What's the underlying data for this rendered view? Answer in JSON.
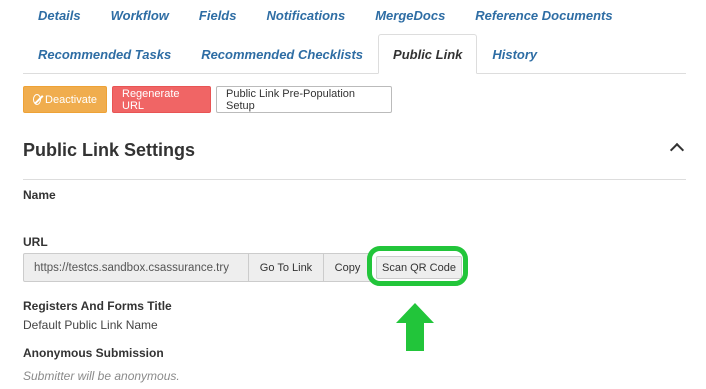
{
  "tabs_row1": [
    "Details",
    "Workflow",
    "Fields",
    "Notifications",
    "MergeDocs",
    "Reference Documents"
  ],
  "tabs_row2": [
    "Recommended Tasks",
    "Recommended Checklists",
    "Public Link",
    "History"
  ],
  "active_tab": "Public Link",
  "buttons": {
    "deactivate": "Deactivate",
    "regenerate": "Regenerate URL",
    "prepopulation": "Public Link Pre-Population Setup"
  },
  "section": {
    "title": "Public Link Settings",
    "name_label": "Name",
    "url_label": "URL",
    "url_value": "https://testcs.sandbox.csassurance.try",
    "go_to_link": "Go To Link",
    "copy": "Copy",
    "scan_qr": "Scan QR Code",
    "registers_label": "Registers And Forms Title",
    "registers_value": "Default Public Link Name",
    "anonymous_label": "Anonymous Submission",
    "anonymous_value": "Submitter will be anonymous."
  },
  "colors": {
    "link_blue": "#2e6da4",
    "warning": "#f0ad4e",
    "danger": "#f06565",
    "highlight_green": "#22c53a"
  }
}
